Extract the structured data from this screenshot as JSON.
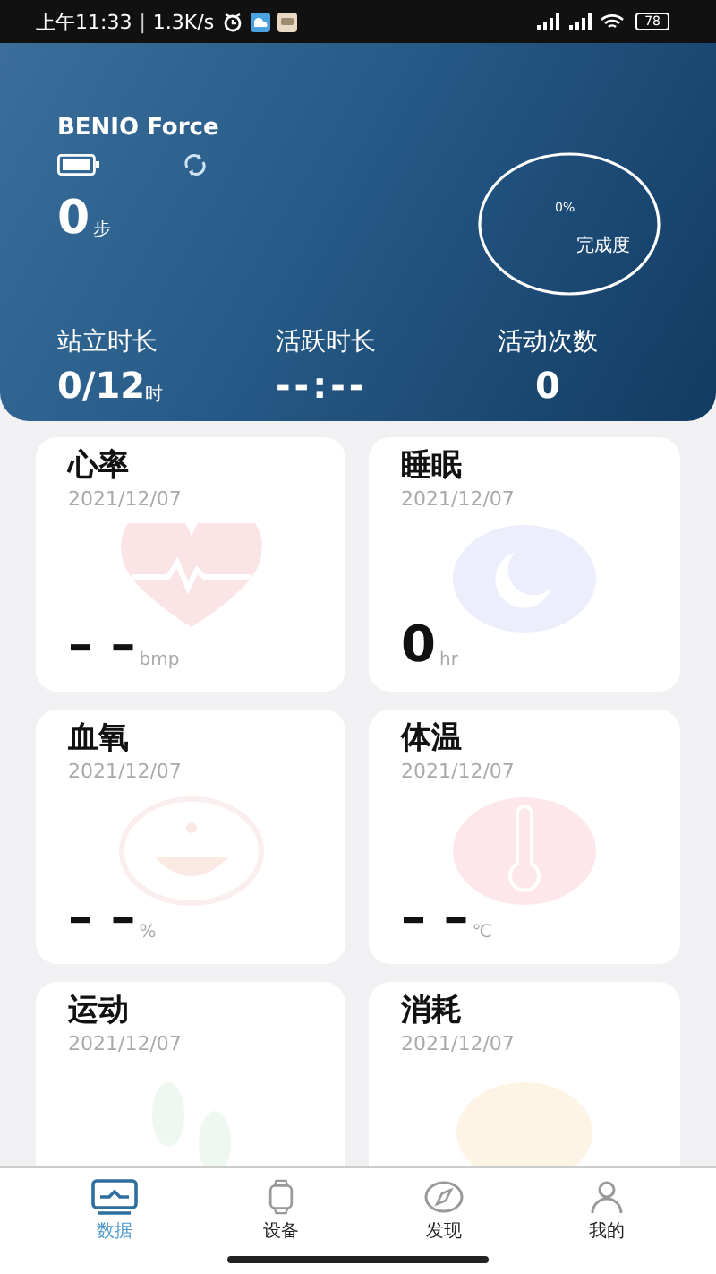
{
  "status_bar": {
    "time": "上午11:33",
    "separator": "|",
    "speed": "1.3K/s",
    "battery": "78"
  },
  "device": {
    "name": "BENIO Force",
    "steps": "0",
    "steps_unit": "步",
    "progress": {
      "percent": "0%",
      "label": "完成度"
    }
  },
  "stats": [
    {
      "label": "站立时长",
      "value": "0/12",
      "unit": "时"
    },
    {
      "label": "活跃时长",
      "value": "--:--"
    },
    {
      "label": "活动次数",
      "value": "0"
    }
  ],
  "cards": [
    {
      "kind": "heart",
      "title": "心率",
      "date": "2021/12/07",
      "value": "– –",
      "unit": "bmp"
    },
    {
      "kind": "sleep",
      "title": "睡眠",
      "date": "2021/12/07",
      "value": "0",
      "unit": "hr"
    },
    {
      "kind": "oxygen",
      "title": "血氧",
      "date": "2021/12/07",
      "value": "– –",
      "unit": "%"
    },
    {
      "kind": "temperature",
      "title": "体温",
      "date": "2021/12/07",
      "value": "– –",
      "unit": "℃"
    },
    {
      "kind": "sport",
      "title": "运动",
      "date": "2021/12/07"
    },
    {
      "kind": "calorie",
      "title": "消耗",
      "date": "2021/12/07"
    }
  ],
  "tabs": [
    {
      "kind": "data",
      "label": "数据",
      "selected": true
    },
    {
      "kind": "device",
      "label": "设备",
      "selected": false
    },
    {
      "kind": "discover",
      "label": "发现",
      "selected": false
    },
    {
      "kind": "mine",
      "label": "我的",
      "selected": false
    }
  ]
}
